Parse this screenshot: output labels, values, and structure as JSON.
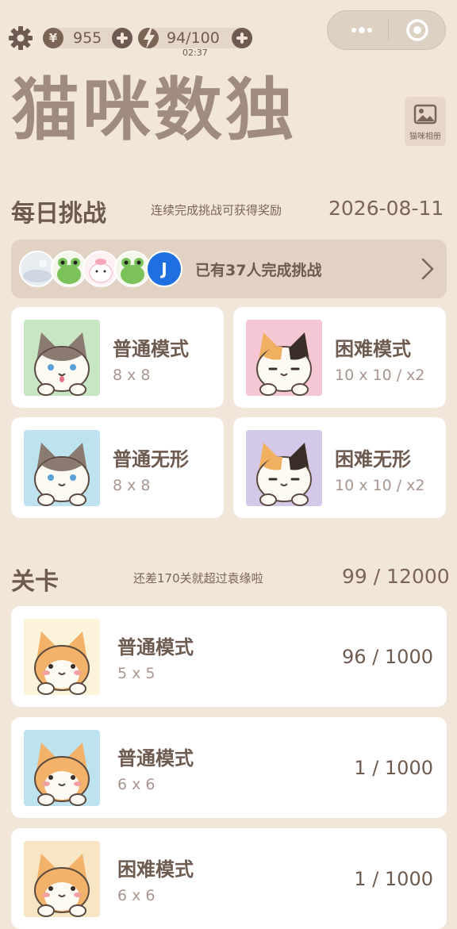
{
  "topbar": {
    "coins": "955",
    "coin_symbol": "¥",
    "energy": "94/100",
    "timer": "02:37"
  },
  "title": "猫咪数独",
  "album": {
    "label": "猫咪相册"
  },
  "daily": {
    "title": "每日挑战",
    "hint": "连续完成挑战可获得奖励",
    "date": "2026-08-11",
    "banner_text": "已有37人完成挑战",
    "avatar_letter": "J",
    "modes": [
      {
        "title": "普通模式",
        "sub": "8 x 8",
        "bg": "#c8e6c4"
      },
      {
        "title": "困难模式",
        "sub": "10 x 10 / x2",
        "bg": "#f5c6d3"
      },
      {
        "title": "普通无形",
        "sub": "8 x 8",
        "bg": "#bfe2ef"
      },
      {
        "title": "困难无形",
        "sub": "10 x 10 / x2",
        "bg": "#d3c8e8"
      }
    ]
  },
  "levels": {
    "title": "关卡",
    "hint": "还差170关就超过袁缘啦",
    "progress": "99 / 12000",
    "items": [
      {
        "title": "普通模式",
        "sub": "5 x 5",
        "count": "96 / 1000",
        "bg": "#fcf4da"
      },
      {
        "title": "普通模式",
        "sub": "6 x 6",
        "count": "1 / 1000",
        "bg": "#bfe2ef"
      },
      {
        "title": "困难模式",
        "sub": "6 x 6",
        "count": "1 / 1000",
        "bg": "#f8e5c4"
      }
    ]
  },
  "colors": {
    "background": "#f2e6d9",
    "text": "#6e5b50",
    "title": "#a08b7f",
    "card": "#ffffff"
  }
}
